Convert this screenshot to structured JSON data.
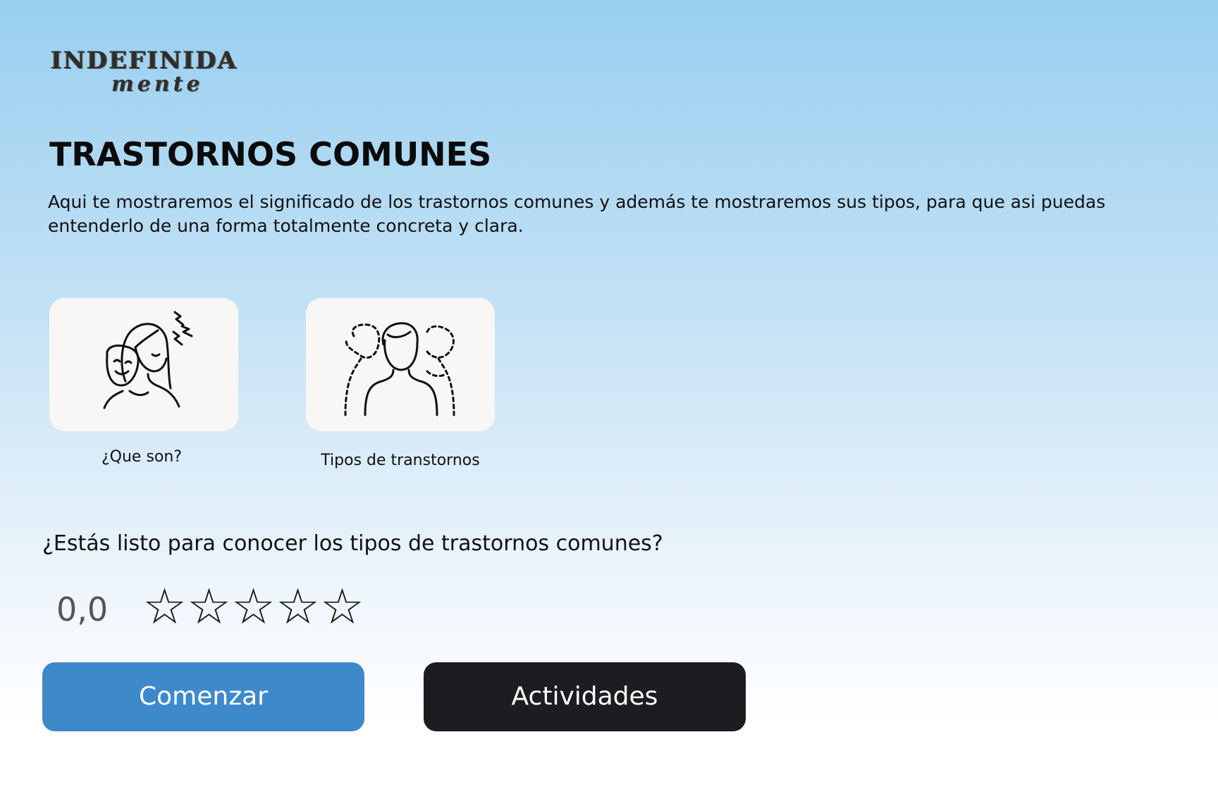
{
  "logo": {
    "line1": "INDEFINIDA",
    "line2": "mente"
  },
  "header": {
    "title": "TRASTORNOS COMUNES"
  },
  "intro": {
    "text": "Aqui te mostraremos el significado de los trastornos comunes y además te mostraremos sus tipos, para que asi puedas entenderlo de una forma totalmente concreta y clara."
  },
  "cards": [
    {
      "label": "¿Que son?",
      "icon": "mask-stress-icon"
    },
    {
      "label": "Tipos de transtornos",
      "icon": "multiple-personalities-icon"
    }
  ],
  "question": {
    "text": "¿Estás listo para conocer los tipos de trastornos comunes?"
  },
  "rating": {
    "value": "0,0",
    "max_stars": 5,
    "filled_stars": 0
  },
  "buttons": {
    "start_label": "Comenzar",
    "activities_label": "Actividades"
  },
  "colors": {
    "start_button": "#3e89ca",
    "activities_button": "#1d1c20",
    "card_background": "#f8f7f5",
    "gradient_top": "#98cff0",
    "gradient_bottom": "#ffffff"
  }
}
